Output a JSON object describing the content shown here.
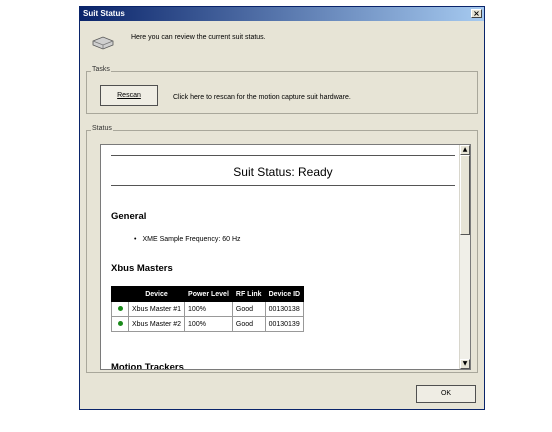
{
  "window": {
    "title": "Suit Status",
    "close_glyph": "×"
  },
  "header": {
    "text": "Here you can review the current suit status.",
    "icon": "suit-device-icon"
  },
  "tasks": {
    "label": "Tasks",
    "rescan_label": "Rescan",
    "description": "Click here to rescan for the motion capture suit hardware."
  },
  "status": {
    "label": "Status",
    "title": "Suit Status: Ready",
    "general_heading": "General",
    "general_items": [
      "XME Sample Frequency: 60 Hz"
    ],
    "xbus_heading": "Xbus Masters",
    "table": {
      "headers": [
        "Device",
        "Power Level",
        "RF Link",
        "Device ID"
      ],
      "rows": [
        {
          "status_color": "#1a8a1a",
          "device": "Xbus Master #1",
          "power": "100%",
          "rf": "Good",
          "id": "00130138"
        },
        {
          "status_color": "#1a8a1a",
          "device": "Xbus Master #2",
          "power": "100%",
          "rf": "Good",
          "id": "00130139"
        }
      ]
    },
    "next_heading_cut": "Motion Trackers"
  },
  "footer": {
    "ok_label": "OK"
  },
  "colors": {
    "titlebar_start": "#0a246a",
    "titlebar_end": "#a6caf0",
    "dialog_bg": "#e7e4d6"
  }
}
